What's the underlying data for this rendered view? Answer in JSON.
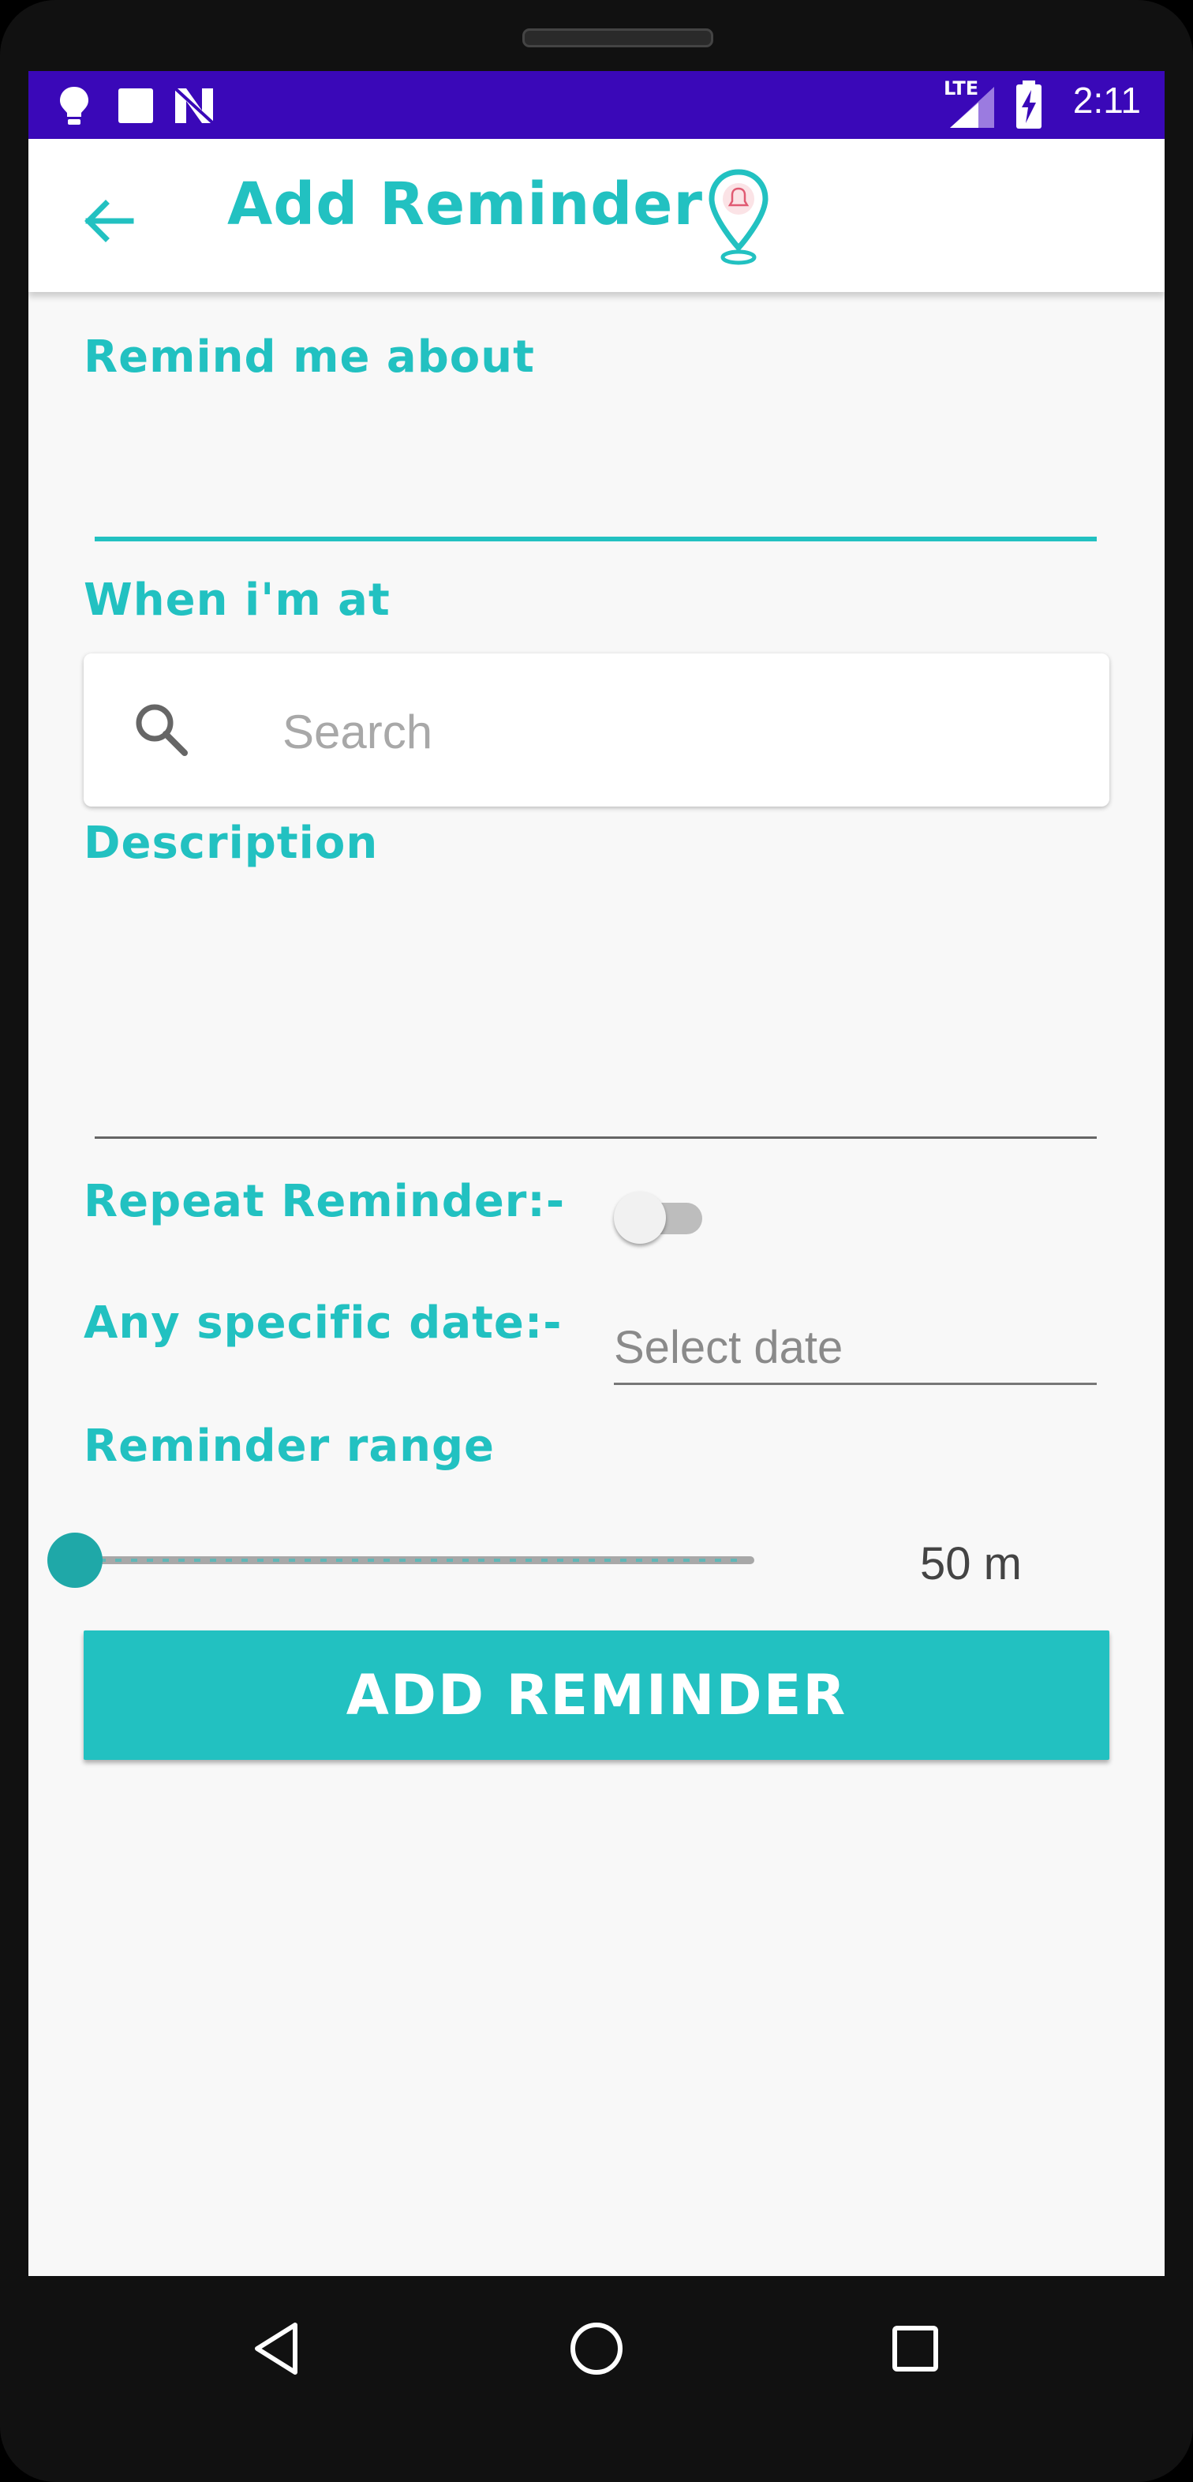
{
  "status_bar": {
    "time": "2:11",
    "network_label": "LTE",
    "icons": [
      "lightbulb-icon",
      "square-icon",
      "n-notification-icon",
      "lte-signal-icon",
      "battery-charging-icon"
    ]
  },
  "app_bar": {
    "title": "Add Reminder",
    "back_icon": "arrow-left-icon",
    "logo_icon": "location-pin-bell-icon"
  },
  "form": {
    "remind_label": "Remind me about",
    "remind_value": "",
    "location_label": "When i'm at",
    "search_placeholder": "Search",
    "description_label": "Description",
    "description_value": "",
    "repeat_label": "Repeat Reminder:-",
    "repeat_enabled": false,
    "date_label": "Any specific date:-",
    "date_placeholder": "Select date",
    "range_label": "Reminder range",
    "range_value_text": "50 m",
    "range_fraction": 0.0,
    "submit_label": "ADD REMINDER"
  },
  "nav_bar": {
    "buttons": [
      "back-triangle-icon",
      "home-circle-icon",
      "recents-square-icon"
    ]
  },
  "colors": {
    "accent": "#22c1c1",
    "status_bar": "#3a08b8",
    "background": "#f8f8f8"
  }
}
